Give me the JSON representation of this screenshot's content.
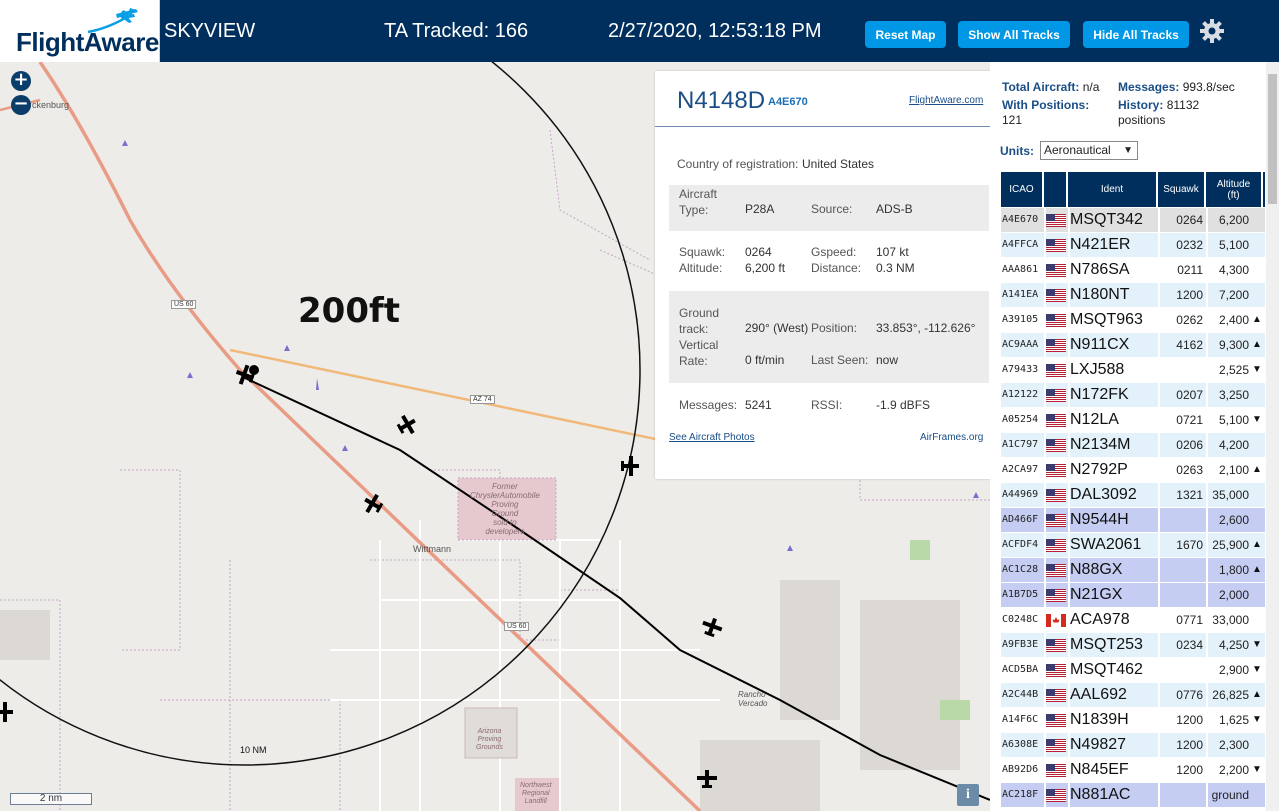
{
  "header": {
    "logo_text": "FlightAware",
    "app_title": "SKYVIEW",
    "ta_tracked": "TA Tracked: 166",
    "datetime": "2/27/2020, 12:53:18 PM",
    "buttons": {
      "reset": "Reset Map",
      "show_all": "Show All Tracks",
      "hide_all": "Hide All Tracks"
    },
    "icons": {
      "settings": "gear-icon",
      "logo": "airplane-icon"
    },
    "colors": {
      "bar": "#002f5d",
      "button": "#0097e6"
    }
  },
  "map": {
    "zoom_in": "+",
    "zoom_out": "−",
    "altitude_annotation": "200ft",
    "range_ring_label": "10 NM",
    "scale_label": "2 nm",
    "info_button": "i",
    "place_labels": {
      "wickenburg": "ckenburg",
      "wittmann": "Wittmann",
      "former_proving": "Former\nChryslerAutomobile\nProving\nGround\nsold to\ndevelopers",
      "rancho_vercado": "Rancho\nVercado",
      "arizona_proving": "Arizona\nProving\nGrounds",
      "northwest_landfill": "Northwest\nRegional\nLandfill"
    },
    "road_labels": {
      "us60_a": "US 60",
      "us60_b": "US 60",
      "az74": "AZ 74"
    }
  },
  "popup": {
    "callsign": "N4148D",
    "hex": "A4E670",
    "fa_link": "FlightAware.com",
    "country_label": "Country of registration:",
    "country_value": "United States",
    "aircraft_type_label": "Aircraft\nType:",
    "aircraft_type_value": "P28A",
    "source_label": "Source:",
    "source_value": "ADS-B",
    "squawk_label": "Squawk:",
    "squawk_value": "0264",
    "gspeed_label": "Gspeed:",
    "gspeed_value": "107 kt",
    "altitude_label": "Altitude:",
    "altitude_value": "6,200 ft",
    "distance_label": "Distance:",
    "distance_value": "0.3 NM",
    "ground_track_label": "Ground\ntrack:",
    "ground_track_value": "290° (West)",
    "position_label": "Position:",
    "position_value": "33.853°, -112.626°",
    "vrate_label": "Vertical\nRate:",
    "vrate_value": "0 ft/min",
    "last_seen_label": "Last Seen:",
    "last_seen_value": "now",
    "messages_label": "Messages:",
    "messages_value": "5241",
    "rssi_label": "RSSI:",
    "rssi_value": "-1.9 dBFS",
    "photos_link": "See Aircraft Photos",
    "airframes_link": "AirFrames.org"
  },
  "panel": {
    "total_aircraft_label": "Total Aircraft:",
    "total_aircraft_value": "n/a",
    "messages_label": "Messages:",
    "messages_value": "993.8/sec",
    "with_positions_label": "With Positions:",
    "with_positions_value": "121",
    "history_label": "History:",
    "history_value": "81132",
    "history_unit": "positions",
    "units_label": "Units:",
    "units_value": "Aeronautical",
    "columns": {
      "icao": "ICAO",
      "ident": "Ident",
      "squawk": "Squawk",
      "altitude": "Altitude\n(ft)"
    }
  },
  "aircraft": [
    {
      "icao": "A4E670",
      "flag": "us",
      "ident": "MSQT342",
      "squawk": "0264",
      "altitude": "6,200",
      "trend": "",
      "style": "sel"
    },
    {
      "icao": "A4FFCA",
      "flag": "us",
      "ident": "N421ER",
      "squawk": "0232",
      "altitude": "5,100",
      "trend": "",
      "style": "c0"
    },
    {
      "icao": "AAA861",
      "flag": "us",
      "ident": "N786SA",
      "squawk": "0211",
      "altitude": "4,300",
      "trend": "",
      "style": "c1"
    },
    {
      "icao": "A141EA",
      "flag": "us",
      "ident": "N180NT",
      "squawk": "1200",
      "altitude": "7,200",
      "trend": "",
      "style": "c0"
    },
    {
      "icao": "A39105",
      "flag": "us",
      "ident": "MSQT963",
      "squawk": "0262",
      "altitude": "2,400",
      "trend": "▲",
      "style": "c1"
    },
    {
      "icao": "AC9AAA",
      "flag": "us",
      "ident": "N911CX",
      "squawk": "4162",
      "altitude": "9,300",
      "trend": "▲",
      "style": "c0"
    },
    {
      "icao": "A79433",
      "flag": "us",
      "ident": "LXJ588",
      "squawk": "",
      "altitude": "2,525",
      "trend": "▼",
      "style": "c1"
    },
    {
      "icao": "A12122",
      "flag": "us",
      "ident": "N172FK",
      "squawk": "0207",
      "altitude": "3,250",
      "trend": "",
      "style": "c0"
    },
    {
      "icao": "A05254",
      "flag": "us",
      "ident": "N12LA",
      "squawk": "0721",
      "altitude": "5,100",
      "trend": "▼",
      "style": "c1"
    },
    {
      "icao": "A1C797",
      "flag": "us",
      "ident": "N2134M",
      "squawk": "0206",
      "altitude": "4,200",
      "trend": "",
      "style": "c0"
    },
    {
      "icao": "A2CA97",
      "flag": "us",
      "ident": "N2792P",
      "squawk": "0263",
      "altitude": "2,100",
      "trend": "▲",
      "style": "c1"
    },
    {
      "icao": "A44969",
      "flag": "us",
      "ident": "DAL3092",
      "squawk": "1321",
      "altitude": "35,000",
      "trend": "",
      "style": "c0"
    },
    {
      "icao": "AD466F",
      "flag": "us",
      "ident": "N9544H",
      "squawk": "",
      "altitude": "2,600",
      "trend": "",
      "style": "noalt"
    },
    {
      "icao": "ACFDF4",
      "flag": "us",
      "ident": "SWA2061",
      "squawk": "1670",
      "altitude": "25,900",
      "trend": "▲",
      "style": "c0"
    },
    {
      "icao": "AC1C28",
      "flag": "us",
      "ident": "N88GX",
      "squawk": "",
      "altitude": "1,800",
      "trend": "▲",
      "style": "noalt"
    },
    {
      "icao": "A1B7D5",
      "flag": "us",
      "ident": "N21GX",
      "squawk": "",
      "altitude": "2,000",
      "trend": "",
      "style": "noalt"
    },
    {
      "icao": "C0248C",
      "flag": "ca",
      "ident": "ACA978",
      "squawk": "0771",
      "altitude": "33,000",
      "trend": "",
      "style": "c1"
    },
    {
      "icao": "A9FB3E",
      "flag": "us",
      "ident": "MSQT253",
      "squawk": "0234",
      "altitude": "4,250",
      "trend": "▼",
      "style": "c0"
    },
    {
      "icao": "ACD5BA",
      "flag": "us",
      "ident": "MSQT462",
      "squawk": "",
      "altitude": "2,900",
      "trend": "▼",
      "style": "c1"
    },
    {
      "icao": "A2C44B",
      "flag": "us",
      "ident": "AAL692",
      "squawk": "0776",
      "altitude": "26,825",
      "trend": "▲",
      "style": "c0"
    },
    {
      "icao": "A14F6C",
      "flag": "us",
      "ident": "N1839H",
      "squawk": "1200",
      "altitude": "1,625",
      "trend": "▼",
      "style": "c1"
    },
    {
      "icao": "A6308E",
      "flag": "us",
      "ident": "N49827",
      "squawk": "1200",
      "altitude": "2,300",
      "trend": "",
      "style": "c0"
    },
    {
      "icao": "AB92D6",
      "flag": "us",
      "ident": "N845EF",
      "squawk": "1200",
      "altitude": "2,200",
      "trend": "▼",
      "style": "c1"
    },
    {
      "icao": "AC218F",
      "flag": "us",
      "ident": "N881AC",
      "squawk": "",
      "altitude": "ground",
      "trend": "",
      "style": "noalt"
    }
  ]
}
